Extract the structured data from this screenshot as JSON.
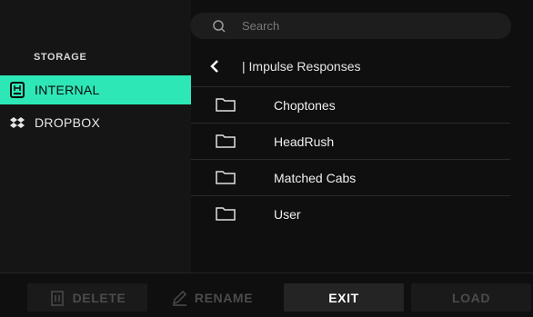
{
  "search": {
    "placeholder": "Search"
  },
  "sidebar": {
    "title": "STORAGE",
    "items": [
      {
        "label": "INTERNAL",
        "active": true,
        "icon": "headrush-icon"
      },
      {
        "label": "DROPBOX",
        "active": false,
        "icon": "dropbox-icon"
      }
    ]
  },
  "browser": {
    "current_path": "| Impulse Responses",
    "folders": [
      "Choptones",
      "HeadRush",
      "Matched Cabs",
      "User"
    ]
  },
  "footer": {
    "delete_label": "DELETE",
    "rename_label": "RENAME",
    "exit_label": "EXIT",
    "load_label": "LOAD"
  },
  "colors": {
    "accent": "#2ee7b6",
    "background": "#0f0f0f",
    "sidebar_bg": "#151515",
    "disabled_text": "#4b4b4b"
  }
}
